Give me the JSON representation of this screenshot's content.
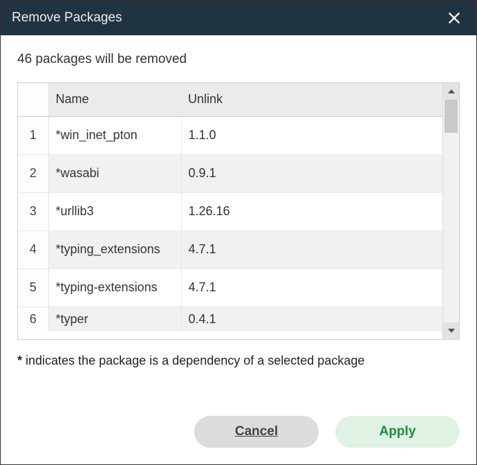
{
  "titlebar": {
    "title": "Remove Packages"
  },
  "summary": "46 packages will be removed",
  "table": {
    "headers": {
      "name": "Name",
      "unlink": "Unlink"
    },
    "rows": [
      {
        "idx": "1",
        "name": "*win_inet_pton",
        "unlink": "1.1.0"
      },
      {
        "idx": "2",
        "name": "*wasabi",
        "unlink": "0.9.1"
      },
      {
        "idx": "3",
        "name": "*urllib3",
        "unlink": "1.26.16"
      },
      {
        "idx": "4",
        "name": "*typing_extensions",
        "unlink": "4.7.1"
      },
      {
        "idx": "5",
        "name": "*typing-extensions",
        "unlink": "4.7.1"
      },
      {
        "idx": "6",
        "name": "*typer",
        "unlink": "0.4.1"
      }
    ]
  },
  "footnote_marker": "*",
  "footnote_text": " indicates the package is a dependency of a selected package",
  "buttons": {
    "cancel": "Cancel",
    "apply": "Apply"
  }
}
